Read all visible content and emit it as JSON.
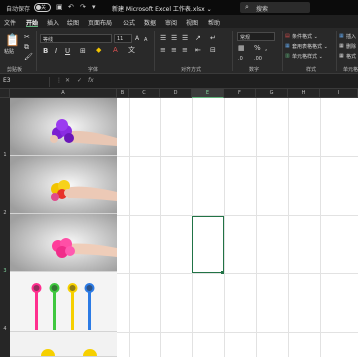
{
  "titlebar": {
    "autosave_label": "自动保存",
    "autosave_state": "关",
    "doc_title": "新建 Microsoft Excel 工作表.xlsx ⌄",
    "search_placeholder": "搜索"
  },
  "menu": {
    "items": [
      "文件",
      "开始",
      "插入",
      "绘图",
      "页面布局",
      "公式",
      "数据",
      "审阅",
      "视图",
      "帮助"
    ],
    "active_index": 1
  },
  "ribbon": {
    "paste_label": "粘贴",
    "font_name": "等线",
    "font_size": "11",
    "number_format": "常规",
    "cond_format": "条件格式 ⌄",
    "table_format": "套用表格格式 ⌄",
    "cell_style": "单元格样式 ⌄",
    "insert_label": "插入",
    "delete_label": "删除",
    "format_label": "格式",
    "groups": {
      "clipboard": "剪贴板",
      "font": "字体",
      "alignment": "对齐方式",
      "number": "数字",
      "styles": "样式",
      "cells": "单元格"
    }
  },
  "formula": {
    "name_box": "E3",
    "fx": "fx",
    "cancel_glyph": "✕",
    "confirm_glyph": "✓",
    "value": ""
  },
  "grid": {
    "columns": [
      "A",
      "B",
      "C",
      "D",
      "E",
      "F",
      "G",
      "H",
      "I"
    ],
    "selected_column": "E",
    "rows": [
      "1",
      "2",
      "3",
      "4"
    ],
    "selected_row": "3",
    "selected_cell": "E3"
  },
  "colors": {
    "accent": "#217346",
    "ui_dark": "#1f1f1f",
    "ribbon": "#292929",
    "toy_purple": "#8a2be2",
    "toy_yellow_red": "#f2c400",
    "toy_pink": "#ff3c9a"
  }
}
